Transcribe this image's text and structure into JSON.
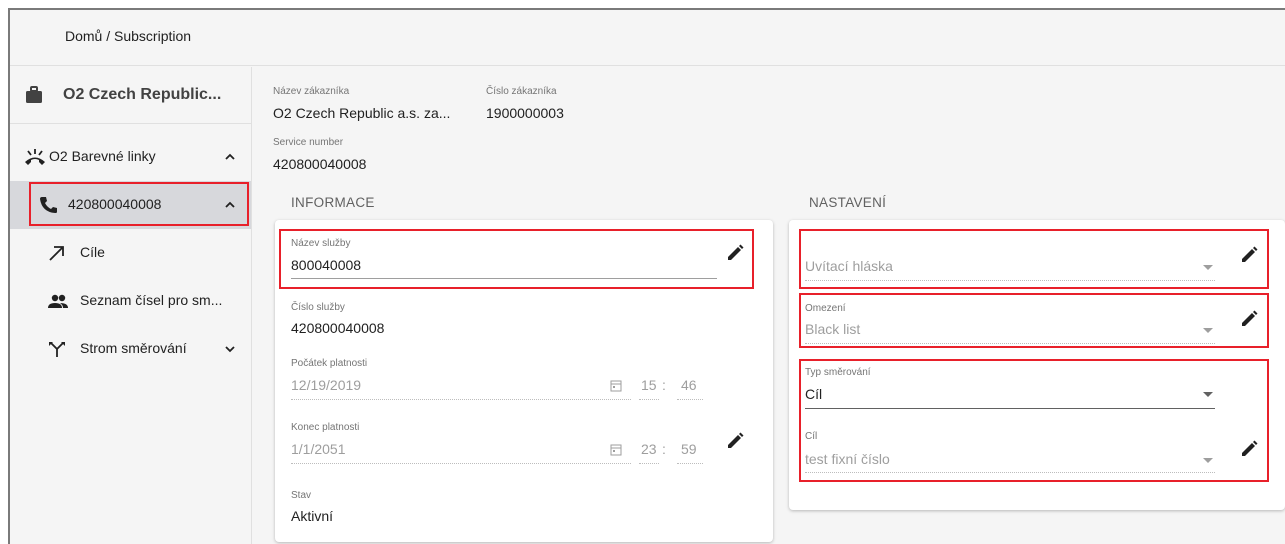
{
  "breadcrumb": "Domů / Subscription",
  "sidebar": {
    "company": "O2 Czech Republic...",
    "items": [
      {
        "label": "O2 Barevné linky",
        "icon": "phone-ringing-icon"
      },
      {
        "label": "420800040008",
        "icon": "phone-icon"
      },
      {
        "label": "Cíle",
        "icon": "arrow-up-right-icon"
      },
      {
        "label": "Seznam čísel pro sm...",
        "icon": "people-icon"
      },
      {
        "label": "Strom směrování",
        "icon": "routing-tree-icon"
      }
    ]
  },
  "customer": {
    "name_label": "Název zákazníka",
    "name_value": "O2 Czech Republic a.s. za...",
    "number_label": "Číslo zákazníka",
    "number_value": "1900000003",
    "service_label": "Service number",
    "service_value": "420800040008"
  },
  "info": {
    "title": "INFORMACE",
    "service_name_label": "Název služby",
    "service_name_value": "800040008",
    "service_number_label": "Číslo služby",
    "service_number_value": "420800040008",
    "valid_from_label": "Počátek platnosti",
    "valid_from_date": "12/19/2019",
    "valid_from_hour": "15",
    "valid_from_min": "46",
    "valid_to_label": "Konec platnosti",
    "valid_to_date": "1/1/2051",
    "valid_to_hour": "23",
    "valid_to_min": "59",
    "time_sep": ":",
    "state_label": "Stav",
    "state_value": "Aktivní"
  },
  "settings": {
    "title": "NASTAVENÍ",
    "greeting_placeholder": "Uvítací hláska",
    "limit_label": "Omezení",
    "limit_value": "Black list",
    "routing_label": "Typ směrování",
    "routing_value": "Cíl",
    "target_label": "Cíl",
    "target_value": "test fixní číslo"
  },
  "colors": {
    "highlight": "#e8202a",
    "active_bg": "#d7d8dc"
  }
}
